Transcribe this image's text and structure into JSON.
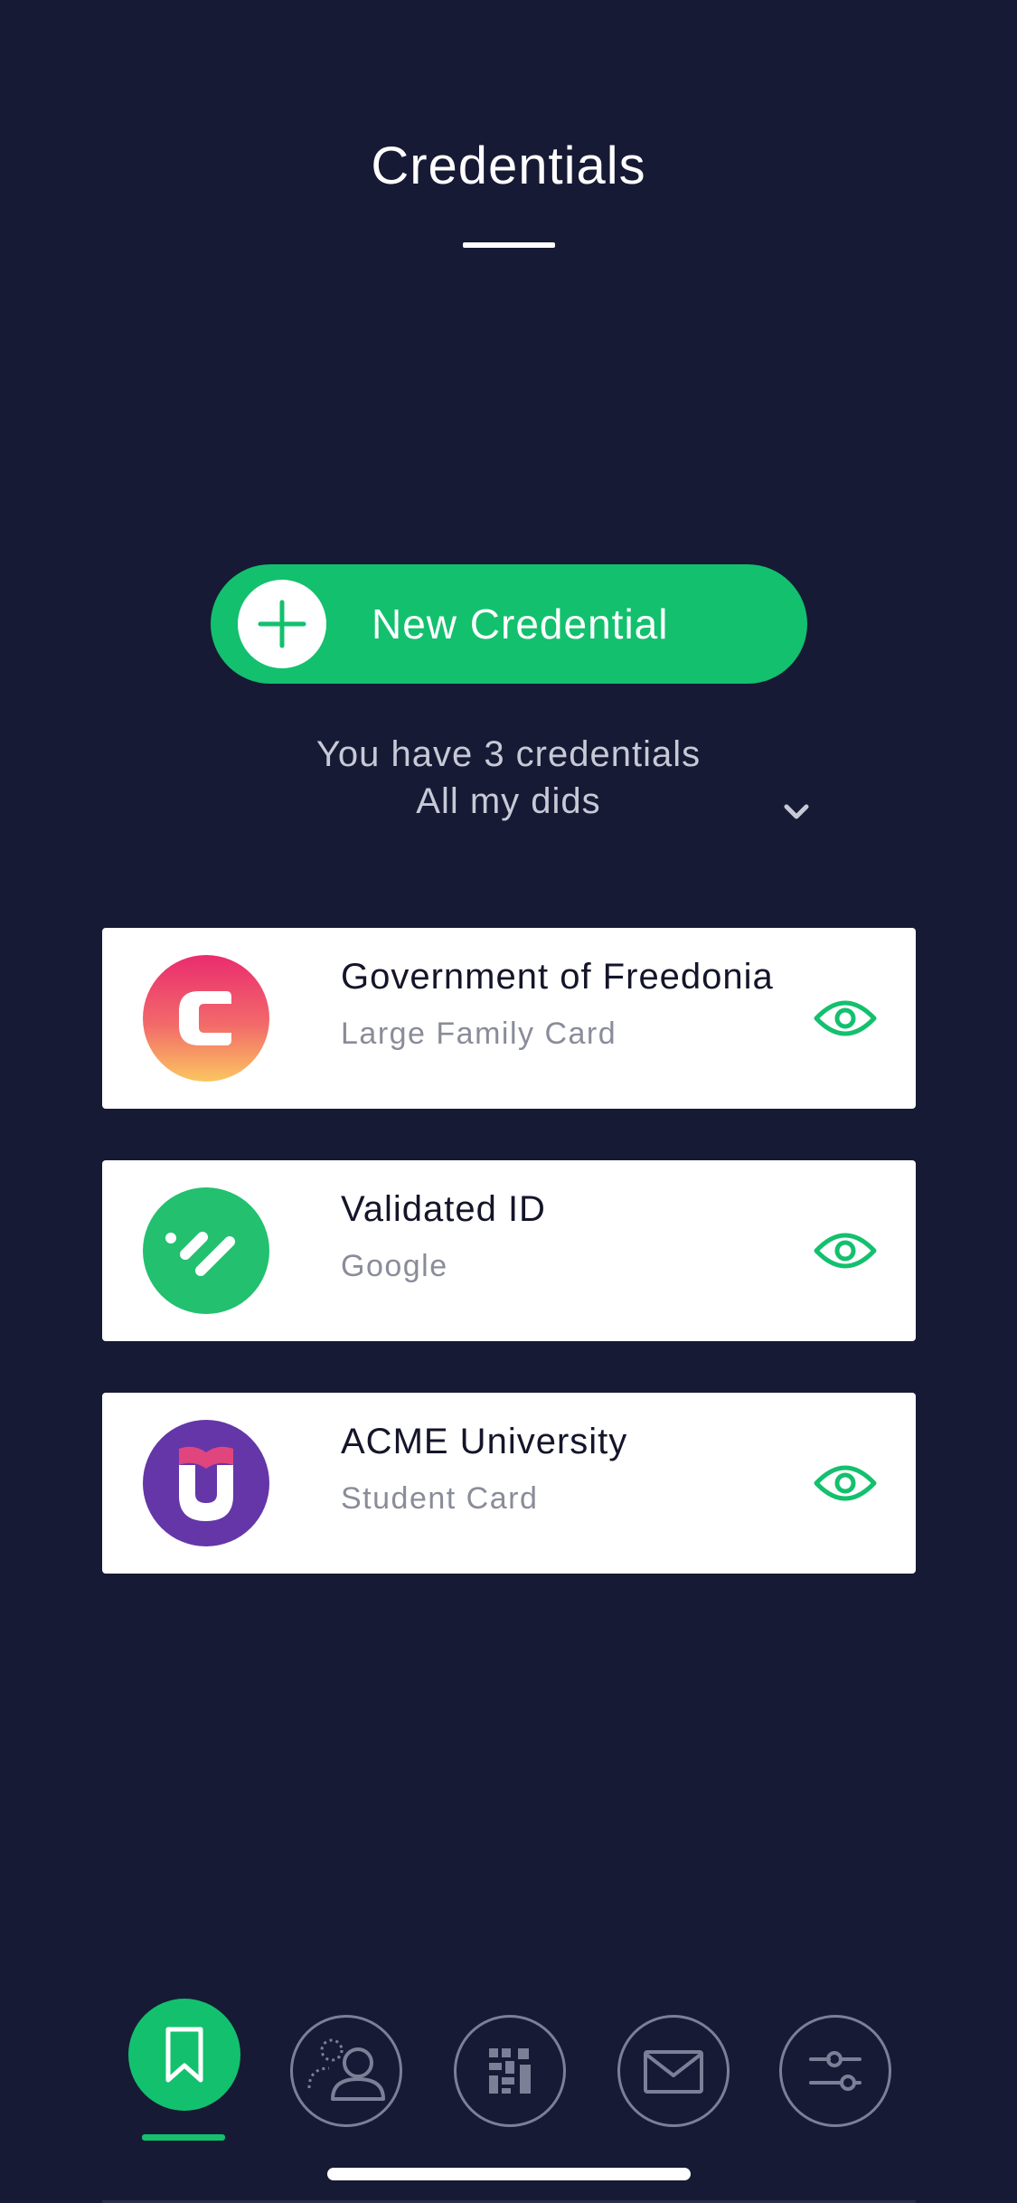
{
  "header": {
    "title": "Credentials"
  },
  "actions": {
    "new_credential_label": "New Credential"
  },
  "summary": {
    "count_text": "You have 3 credentials",
    "did_filter": "All my dids"
  },
  "credentials": [
    {
      "issuer": "Government of Freedonia",
      "type": "Large Family Card",
      "logo_icon": "freedonia-logo-icon"
    },
    {
      "issuer": "Validated ID",
      "type": "Google",
      "logo_icon": "validated-id-logo-icon"
    },
    {
      "issuer": "ACME University",
      "type": "Student Card",
      "logo_icon": "acme-university-logo-icon"
    }
  ],
  "tabbar": {
    "items": [
      {
        "icon": "bookmark-icon",
        "active": true
      },
      {
        "icon": "contacts-icon",
        "active": false
      },
      {
        "icon": "qr-code-icon",
        "active": false
      },
      {
        "icon": "mail-icon",
        "active": false
      },
      {
        "icon": "settings-sliders-icon",
        "active": false
      }
    ]
  },
  "colors": {
    "background": "#171a35",
    "accent": "#13c06e",
    "card": "#ffffff",
    "muted_text": "#8a8c99",
    "inactive_icon": "#7c7f96"
  }
}
